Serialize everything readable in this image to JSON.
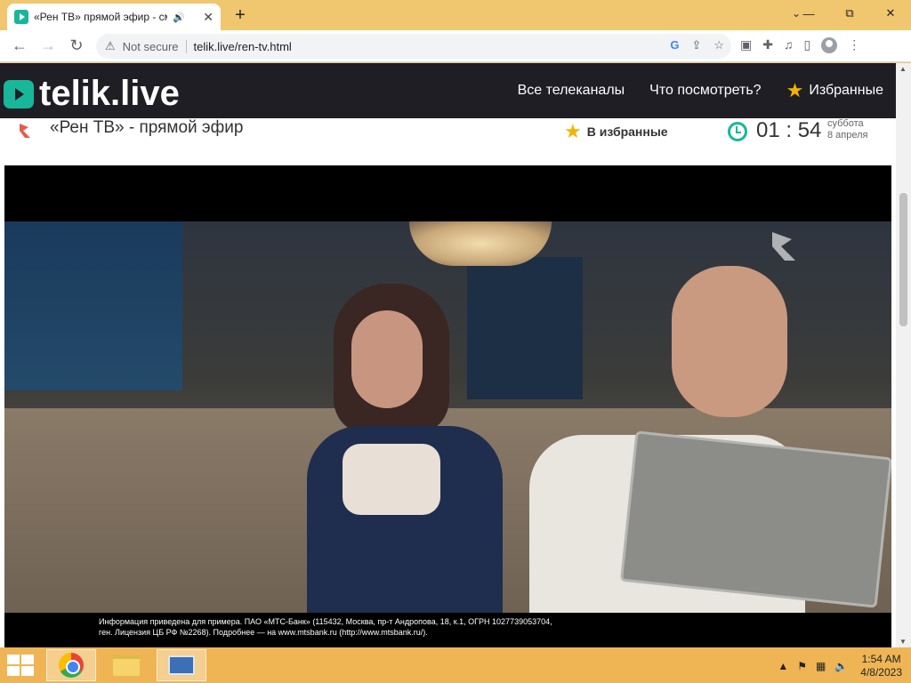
{
  "browser": {
    "tab": {
      "title": "«Рен ТВ» прямой эфир - смотреть онлайн",
      "audio_icon": "speaker-icon"
    },
    "new_tab_label": "+",
    "window_controls": {
      "chevron": "⌄",
      "minimize": "—",
      "restore": "⧉",
      "close": "✕"
    },
    "nav": {
      "back": "←",
      "forward": "→",
      "reload": "↻"
    },
    "address_bar": {
      "security_label": "Not secure",
      "url": "telik.live/ren-tv.html"
    }
  },
  "site": {
    "logo_text": "telik.live",
    "nav": {
      "all_channels": "Все телеканалы",
      "what_to_watch": "Что посмотреть?",
      "favorites": "Избранные"
    },
    "channel_title": "«Рен ТВ» - прямой эфир",
    "add_favorite": "В избранные",
    "clock": {
      "time": "01 : 54",
      "weekday": "суббота",
      "date": "8 апреля"
    }
  },
  "video": {
    "disclaimer_line1": "Информация приведена для примера. ПАО «МТС-Банк» (115432, Москва, пр-т Андропова, 18, к.1, ОГРН 1027739053704,",
    "disclaimer_line2": "ген. Лицензия ЦБ РФ №2268). Подробнее — на www.mtsbank.ru (http://www.mtsbank.ru/)."
  },
  "taskbar": {
    "apps": [
      "chrome-icon",
      "file-explorer-icon",
      "computer-icon"
    ],
    "tray": {
      "time": "1:54 AM",
      "date": "4/8/2023"
    }
  },
  "colors": {
    "accent": "#18b79a",
    "header_bg": "#1e1e24",
    "star": "#f5b301",
    "taskbar": "#efb554"
  }
}
